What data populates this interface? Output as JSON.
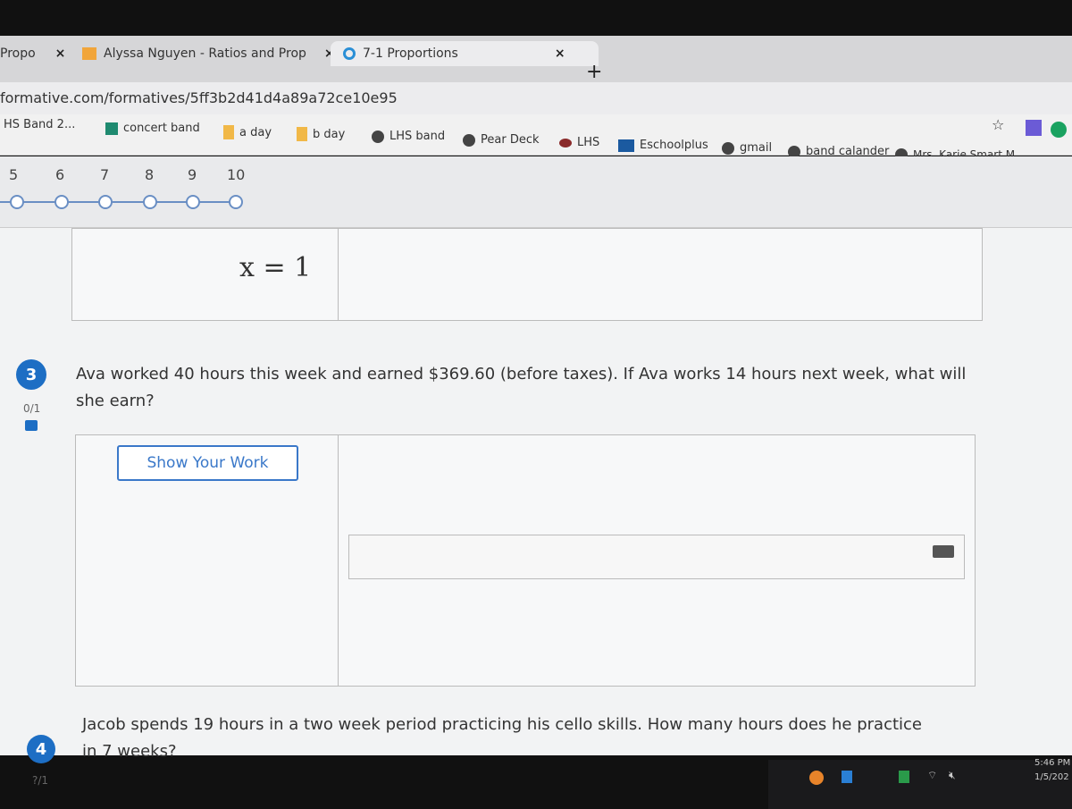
{
  "browser": {
    "tabs": [
      {
        "label": "Propo",
        "active": false
      },
      {
        "label": "Alyssa Nguyen - Ratios and Prop",
        "active": false
      },
      {
        "label": "7-1 Proportions",
        "active": true
      }
    ],
    "close_symbol": "×",
    "new_tab_symbol": "+",
    "url": "formative.com/formatives/5ff3b2d41d4a89a72ce10e95",
    "bookmarks": [
      {
        "label": "HS Band 2...",
        "icon": "globe"
      },
      {
        "label": "concert band",
        "icon": "classroom"
      },
      {
        "label": "a day",
        "icon": "folder"
      },
      {
        "label": "b day",
        "icon": "folder"
      },
      {
        "label": "LHS band",
        "icon": "globe"
      },
      {
        "label": "Pear Deck",
        "icon": "globe"
      },
      {
        "label": "LHS",
        "icon": "mascot"
      },
      {
        "label": "Eschoolplus",
        "icon": "hac"
      },
      {
        "label": "gmail",
        "icon": "globe"
      },
      {
        "label": "band calander",
        "icon": "globe"
      },
      {
        "label": "Mrs. Karie Smart M...",
        "icon": "globe"
      }
    ],
    "star_symbol": "☆"
  },
  "stepper": {
    "numbers": [
      "5",
      "6",
      "7",
      "8",
      "9",
      "10"
    ]
  },
  "previous_answer": {
    "handwriting": "x = 1"
  },
  "questions": [
    {
      "number": "3",
      "text": "Ava worked 40 hours this week and earned $369.60 (before taxes). If Ava works 14 hours next week, what will she earn?",
      "score": "0/1",
      "show_work_label": "Show Your Work",
      "answer_value": ""
    },
    {
      "number": "4",
      "text": "Jacob spends 19 hours in a two week period practicing his cello skills. How many hours does he practice in 7 weeks?",
      "score": "?/1"
    }
  ],
  "taskbar": {
    "time": "5:46 PM",
    "date": "1/5/202"
  },
  "colors": {
    "accent": "#1d6ec4",
    "stepper": "#6a8fc4"
  }
}
